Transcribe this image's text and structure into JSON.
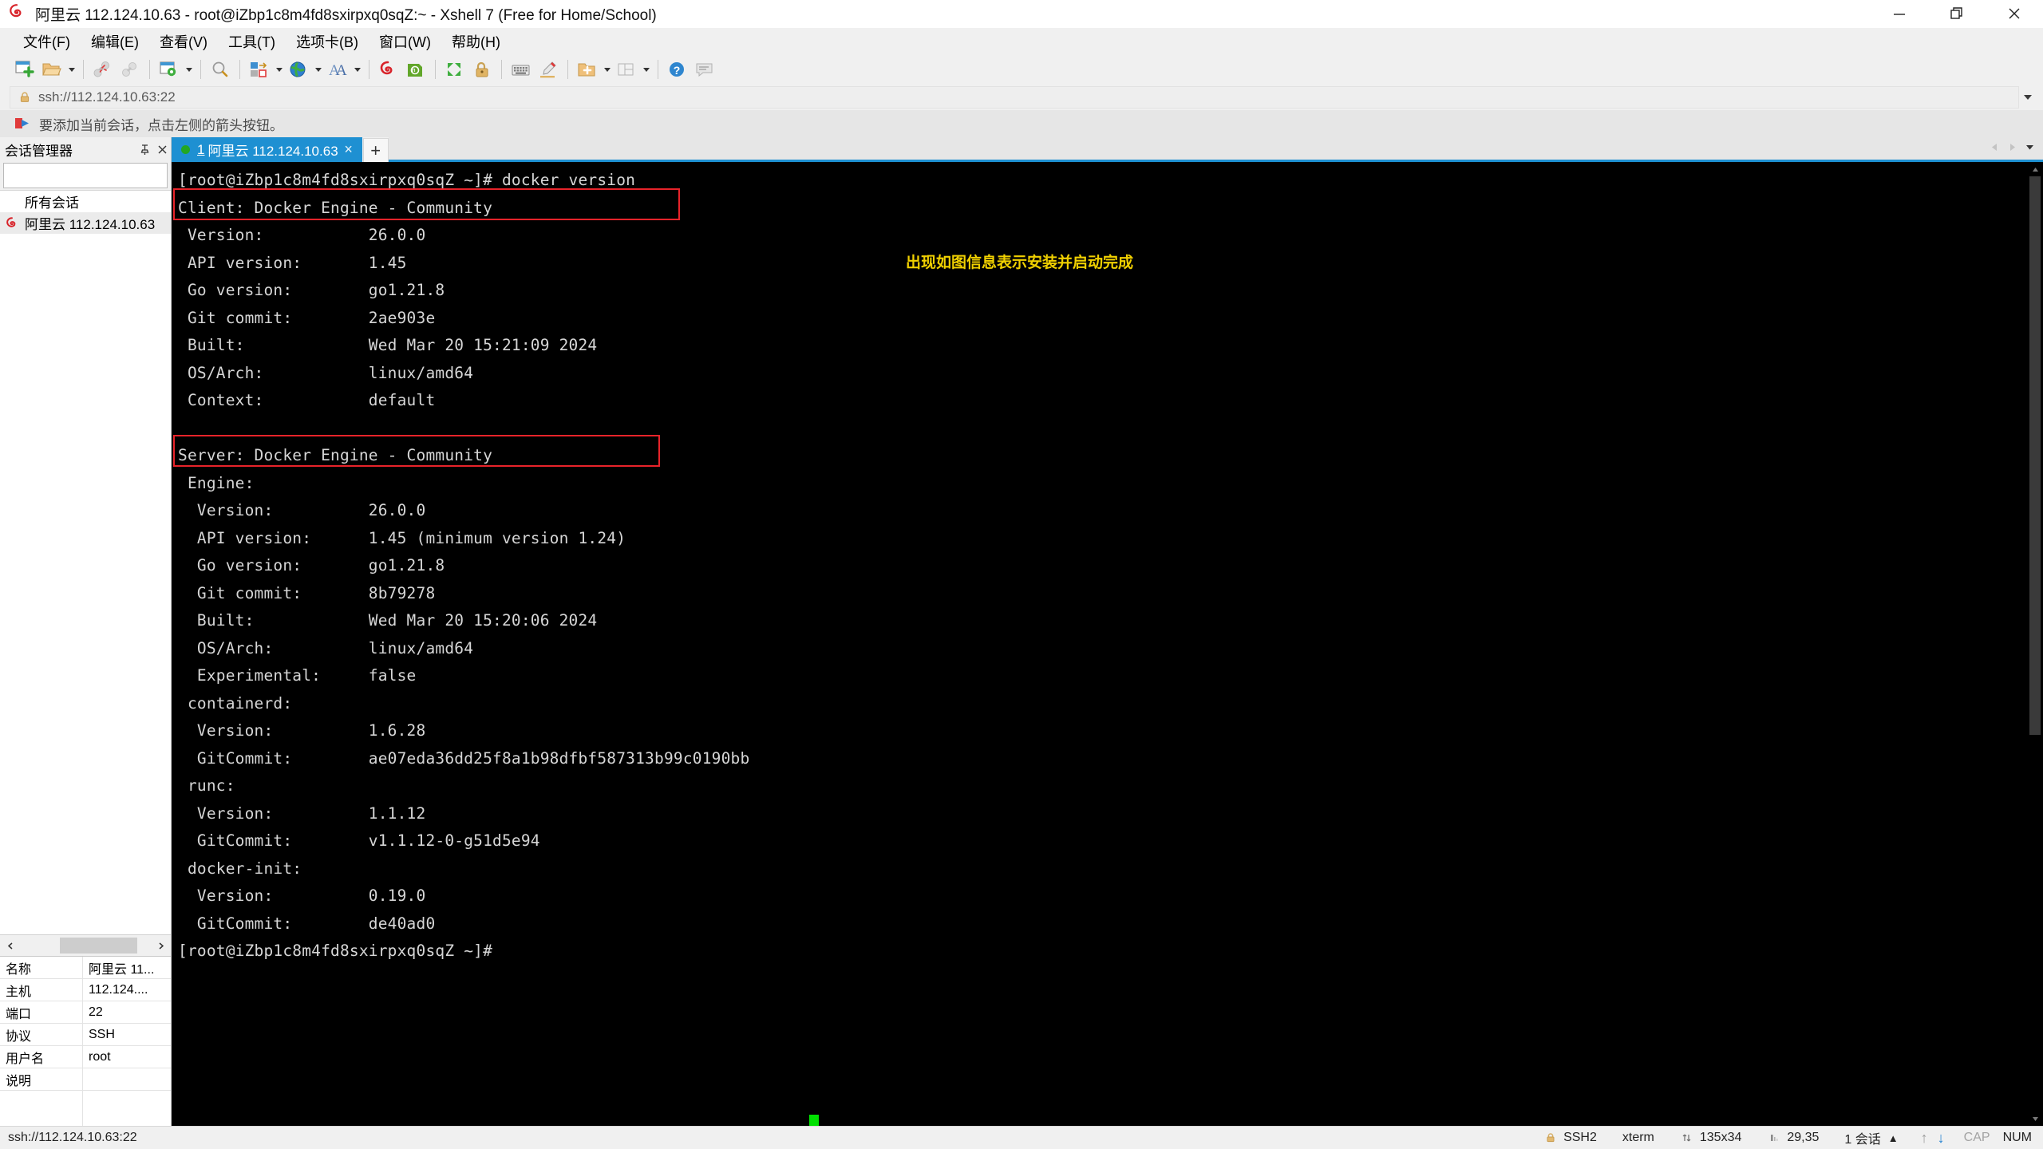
{
  "window": {
    "title": "阿里云 112.124.10.63 - root@iZbp1c8m4fd8sxirpxq0sqZ:~ - Xshell 7 (Free for Home/School)",
    "app_icon": "alicloud-logo",
    "minimize_label": "最小化",
    "restore_label": "还原",
    "close_label": "关闭"
  },
  "menubar": {
    "items": [
      {
        "label": "文件(F)",
        "name": "menu-file"
      },
      {
        "label": "编辑(E)",
        "name": "menu-edit"
      },
      {
        "label": "查看(V)",
        "name": "menu-view"
      },
      {
        "label": "工具(T)",
        "name": "menu-tools"
      },
      {
        "label": "选项卡(B)",
        "name": "menu-tabs"
      },
      {
        "label": "窗口(W)",
        "name": "menu-window"
      },
      {
        "label": "帮助(H)",
        "name": "menu-help"
      }
    ]
  },
  "toolbar": {
    "icons": [
      "new-session-icon",
      "open-folder-icon",
      "disconnect-icon",
      "reconnect-icon",
      "session-properties-icon",
      "find-icon",
      "transfer-file-icon",
      "globe-icon",
      "font-icon",
      "xftp-icon",
      "xshell-green-icon",
      "fullscreen-icon",
      "lock-icon",
      "keyboard-icon",
      "highlight-pen-icon",
      "add-folder-icon",
      "layout-icon",
      "help-icon",
      "comment-icon"
    ]
  },
  "address_bar": {
    "value": "ssh://112.124.10.63:22",
    "icon": "lock-icon",
    "dropdown": "chevron-down-icon"
  },
  "notice": {
    "icon": "red-blue-arrow-icon",
    "text": "要添加当前会话，点击左侧的箭头按钮。"
  },
  "sidebar": {
    "title": "会话管理器",
    "pin_icon": "pin-icon",
    "close_icon": "close-icon",
    "search": {
      "value": "",
      "placeholder": "",
      "icon": "search-icon"
    },
    "tree": {
      "root_label": "所有会话",
      "items": [
        {
          "label": "阿里云 112.124.10.63",
          "icon": "alicloud-logo",
          "selected": true
        }
      ]
    },
    "properties": [
      {
        "key": "名称",
        "value": "阿里云 11..."
      },
      {
        "key": "主机",
        "value": "112.124...."
      },
      {
        "key": "端口",
        "value": "22"
      },
      {
        "key": "协议",
        "value": "SSH"
      },
      {
        "key": "用户名",
        "value": "root"
      },
      {
        "key": "说明",
        "value": ""
      }
    ]
  },
  "tabs": {
    "items": [
      {
        "number": "1",
        "label": "阿里云 112.124.10.63",
        "status": "connected",
        "close_label": "×"
      }
    ],
    "new_tab_label": "+",
    "prev_label": "◀",
    "next_label": "▶",
    "list_label": "▼"
  },
  "terminal": {
    "prompt": "[root@iZbp1c8m4fd8sxirpxq0sqZ ~]#",
    "command": "docker version",
    "lines": [
      "[root@iZbp1c8m4fd8sxirpxq0sqZ ~]# docker version",
      "Client: Docker Engine - Community",
      " Version:           26.0.0",
      " API version:       1.45",
      " Go version:        go1.21.8",
      " Git commit:        2ae903e",
      " Built:             Wed Mar 20 15:21:09 2024",
      " OS/Arch:           linux/amd64",
      " Context:           default",
      "",
      "Server: Docker Engine - Community",
      " Engine:",
      "  Version:          26.0.0",
      "  API version:      1.45 (minimum version 1.24)",
      "  Go version:       go1.21.8",
      "  Git commit:       8b79278",
      "  Built:            Wed Mar 20 15:20:06 2024",
      "  OS/Arch:          linux/amd64",
      "  Experimental:     false",
      " containerd:",
      "  Version:          1.6.28",
      "  GitCommit:        ae07eda36dd25f8a1b98dfbf587313b99c0190bb",
      " runc:",
      "  Version:          1.1.12",
      "  GitCommit:        v1.1.12-0-g51d5e94",
      " docker-init:",
      "  Version:          0.19.0",
      "  GitCommit:        de40ad0",
      "[root@iZbp1c8m4fd8sxirpxq0sqZ ~]# "
    ],
    "annotation": "出现如图信息表示安装并启动完成",
    "annotation_color": "#f0d000",
    "highlight_color": "#e8232a",
    "background": "#000000",
    "foreground": "#d6d6d6",
    "cursor_color": "#00e000"
  },
  "statusbar": {
    "connection": "ssh://112.124.10.63:22",
    "security": "SSH2",
    "security_icon": "lock-icon",
    "terminal_type": "xterm",
    "size": "135x34",
    "size_icon": "resize-icon",
    "cursor_pos": "29,35",
    "cursor_icon": "cursor-icon",
    "sessions": "1 会话",
    "sessions_caret": "▲",
    "upload_icon": "arrow-up-icon",
    "download_icon": "arrow-down-icon",
    "cap": "CAP",
    "num": "NUM"
  }
}
